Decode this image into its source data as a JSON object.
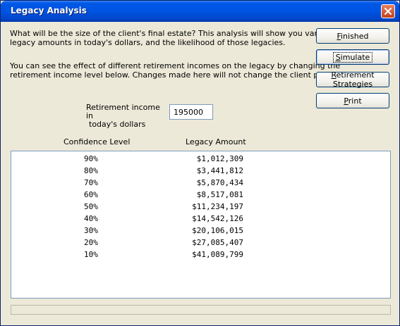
{
  "window": {
    "title": "Legacy Analysis"
  },
  "intro": {
    "line1": "What will be the size of the client's final estate?  This analysis will show you various",
    "line2": "legacy amounts in today's dollars, and the likelihood of those legacies.",
    "line3": "You can see the effect of different retirement incomes on the legacy by changing the",
    "line4": "retirement income level below.  Changes made here will not change the client profile."
  },
  "buttons": {
    "finished": "Finished",
    "simulate": "Simulate",
    "strategies": "Retirement Strategies",
    "print": "Print"
  },
  "income": {
    "label_line1": "Retirement income in",
    "label_line2": "today's dollars",
    "value": "195000"
  },
  "table": {
    "headers": {
      "confidence": "Confidence Level",
      "legacy": "Legacy Amount"
    },
    "rows": [
      {
        "confidence": "90%",
        "legacy": "$1,012,309"
      },
      {
        "confidence": "80%",
        "legacy": "$3,441,812"
      },
      {
        "confidence": "70%",
        "legacy": "$5,870,434"
      },
      {
        "confidence": "60%",
        "legacy": "$8,517,081"
      },
      {
        "confidence": "50%",
        "legacy": "$11,234,197"
      },
      {
        "confidence": "40%",
        "legacy": "$14,542,126"
      },
      {
        "confidence": "30%",
        "legacy": "$20,106,015"
      },
      {
        "confidence": "20%",
        "legacy": "$27,085,407"
      },
      {
        "confidence": "10%",
        "legacy": "$41,089,799"
      }
    ]
  },
  "icons": {
    "close": "close-icon"
  },
  "colors": {
    "title_bar": "#0054e3",
    "window_bg": "#ece9d8",
    "close_button": "#c4411e"
  }
}
